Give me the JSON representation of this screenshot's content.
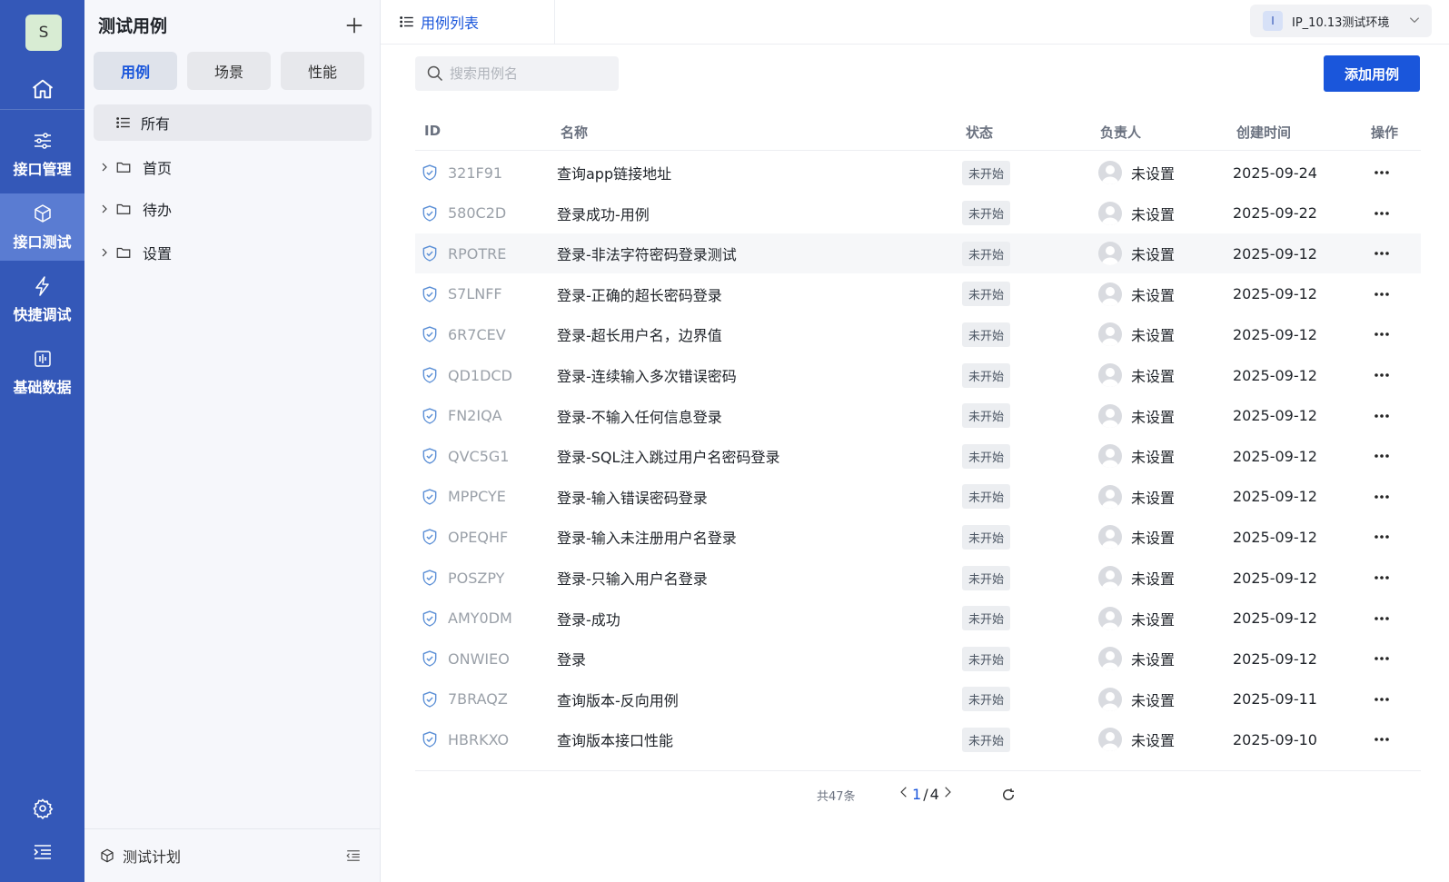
{
  "rail": {
    "avatar_letter": "S",
    "items": [
      {
        "label": "接口管理",
        "icon": "sliders-icon"
      },
      {
        "label": "接口测试",
        "icon": "cube-icon",
        "active": true
      },
      {
        "label": "快捷调试",
        "icon": "lightning-icon"
      },
      {
        "label": "基础数据",
        "icon": "chart-icon"
      }
    ]
  },
  "sidebar": {
    "title": "测试用例",
    "segments": [
      {
        "label": "用例",
        "active": true
      },
      {
        "label": "场景"
      },
      {
        "label": "性能"
      }
    ],
    "tree_all_label": "所有",
    "tree_nodes": [
      "首页",
      "待办",
      "设置"
    ],
    "footer_label": "测试计划"
  },
  "topbar": {
    "tab_label": "用例列表",
    "env_badge": "I",
    "env_label": "IP_10.13测试环境"
  },
  "toolbar": {
    "search_placeholder": "搜索用例名",
    "add_button": "添加用例"
  },
  "table": {
    "headers": {
      "id": "ID",
      "name": "名称",
      "status": "状态",
      "owner": "负责人",
      "created": "创建时间",
      "actions": "操作"
    },
    "rows": [
      {
        "id": "321F91",
        "name": "查询app链接地址",
        "status": "未开始",
        "owner": "未设置",
        "created": "2025-09-24"
      },
      {
        "id": "580C2D",
        "name": "登录成功-用例",
        "status": "未开始",
        "owner": "未设置",
        "created": "2025-09-22"
      },
      {
        "id": "RPOTRE",
        "name": "登录-非法字符密码登录测试",
        "status": "未开始",
        "owner": "未设置",
        "created": "2025-09-12"
      },
      {
        "id": "S7LNFF",
        "name": "登录-正确的超长密码登录",
        "status": "未开始",
        "owner": "未设置",
        "created": "2025-09-12"
      },
      {
        "id": "6R7CEV",
        "name": "登录-超长用户名，边界值",
        "status": "未开始",
        "owner": "未设置",
        "created": "2025-09-12"
      },
      {
        "id": "QD1DCD",
        "name": "登录-连续输入多次错误密码",
        "status": "未开始",
        "owner": "未设置",
        "created": "2025-09-12"
      },
      {
        "id": "FN2IQA",
        "name": "登录-不输入任何信息登录",
        "status": "未开始",
        "owner": "未设置",
        "created": "2025-09-12"
      },
      {
        "id": "QVC5G1",
        "name": "登录-SQL注入跳过用户名密码登录",
        "status": "未开始",
        "owner": "未设置",
        "created": "2025-09-12"
      },
      {
        "id": "MPPCYE",
        "name": "登录-输入错误密码登录",
        "status": "未开始",
        "owner": "未设置",
        "created": "2025-09-12"
      },
      {
        "id": "OPEQHF",
        "name": "登录-输入未注册用户名登录",
        "status": "未开始",
        "owner": "未设置",
        "created": "2025-09-12"
      },
      {
        "id": "POSZPY",
        "name": "登录-只输入用户名登录",
        "status": "未开始",
        "owner": "未设置",
        "created": "2025-09-12"
      },
      {
        "id": "AMY0DM",
        "name": "登录-成功",
        "status": "未开始",
        "owner": "未设置",
        "created": "2025-09-12"
      },
      {
        "id": "ONWIEO",
        "name": "登录",
        "status": "未开始",
        "owner": "未设置",
        "created": "2025-09-12"
      },
      {
        "id": "7BRAQZ",
        "name": "查询版本-反向用例",
        "status": "未开始",
        "owner": "未设置",
        "created": "2025-09-11"
      },
      {
        "id": "HBRKXO",
        "name": "查询版本接口性能",
        "status": "未开始",
        "owner": "未设置",
        "created": "2025-09-10"
      }
    ],
    "hover_row_index": 2
  },
  "pagination": {
    "total_label": "共47条",
    "current_page": "1",
    "separator": "/",
    "total_pages": "4"
  },
  "colors": {
    "rail_bg": "#3458b8",
    "rail_active": "#5a7cd2",
    "accent": "#1a56db",
    "sidebar_bg": "#f6f7fb"
  }
}
